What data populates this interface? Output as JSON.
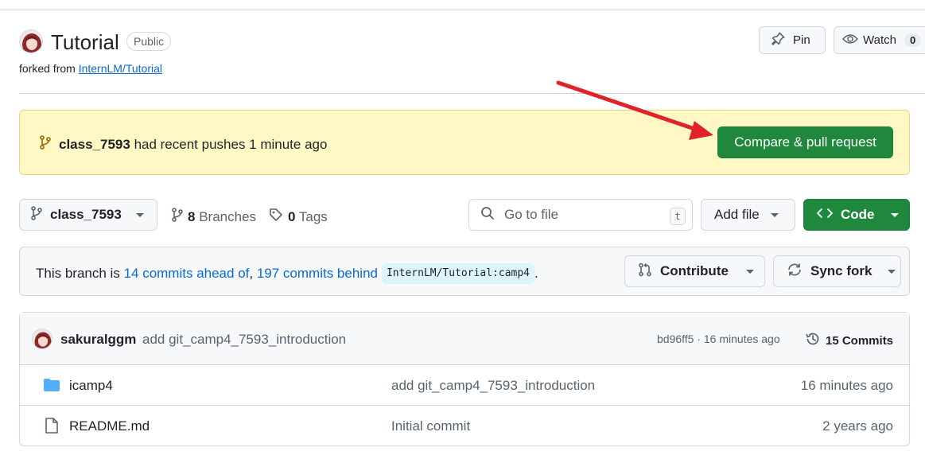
{
  "repo": {
    "name": "Tutorial",
    "visibility": "Public",
    "forked_from_prefix": "forked from",
    "forked_from_link": "InternLM/Tutorial"
  },
  "header_actions": {
    "pin_label": "Pin",
    "watch_label": "Watch",
    "watch_count": "0"
  },
  "push_banner": {
    "branch": "class_7593",
    "message": "had recent pushes 1 minute ago",
    "button_label": "Compare & pull request"
  },
  "toolbar": {
    "current_branch": "class_7593",
    "branches_count": "8",
    "branches_label": "Branches",
    "tags_count": "0",
    "tags_label": "Tags",
    "search_placeholder": "Go to file",
    "search_shortcut": "t",
    "add_file_label": "Add file",
    "code_label": "Code"
  },
  "branch_status": {
    "prefix": "This branch is",
    "ahead_text": "14 commits ahead of",
    "separator": ",",
    "behind_text": "197 commits behind",
    "ref": "InternLM/Tutorial:camp4",
    "suffix": ".",
    "contribute_label": "Contribute",
    "sync_label": "Sync fork"
  },
  "latest_commit": {
    "author": "sakuralggm",
    "message": "add git_camp4_7593_introduction",
    "sha_time": "bd96ff5 · 16 minutes ago",
    "commits_label": "15 Commits"
  },
  "files": [
    {
      "type": "folder",
      "name": "icamp4",
      "message": "add git_camp4_7593_introduction",
      "date": "16 minutes ago"
    },
    {
      "type": "file",
      "name": "README.md",
      "message": "Initial commit",
      "date": "2 years ago"
    }
  ],
  "colors": {
    "accent_green": "#1f883d",
    "link_blue": "#0969da",
    "banner_yellow": "#fff8c5",
    "annotation_arrow": "#e0222a"
  }
}
